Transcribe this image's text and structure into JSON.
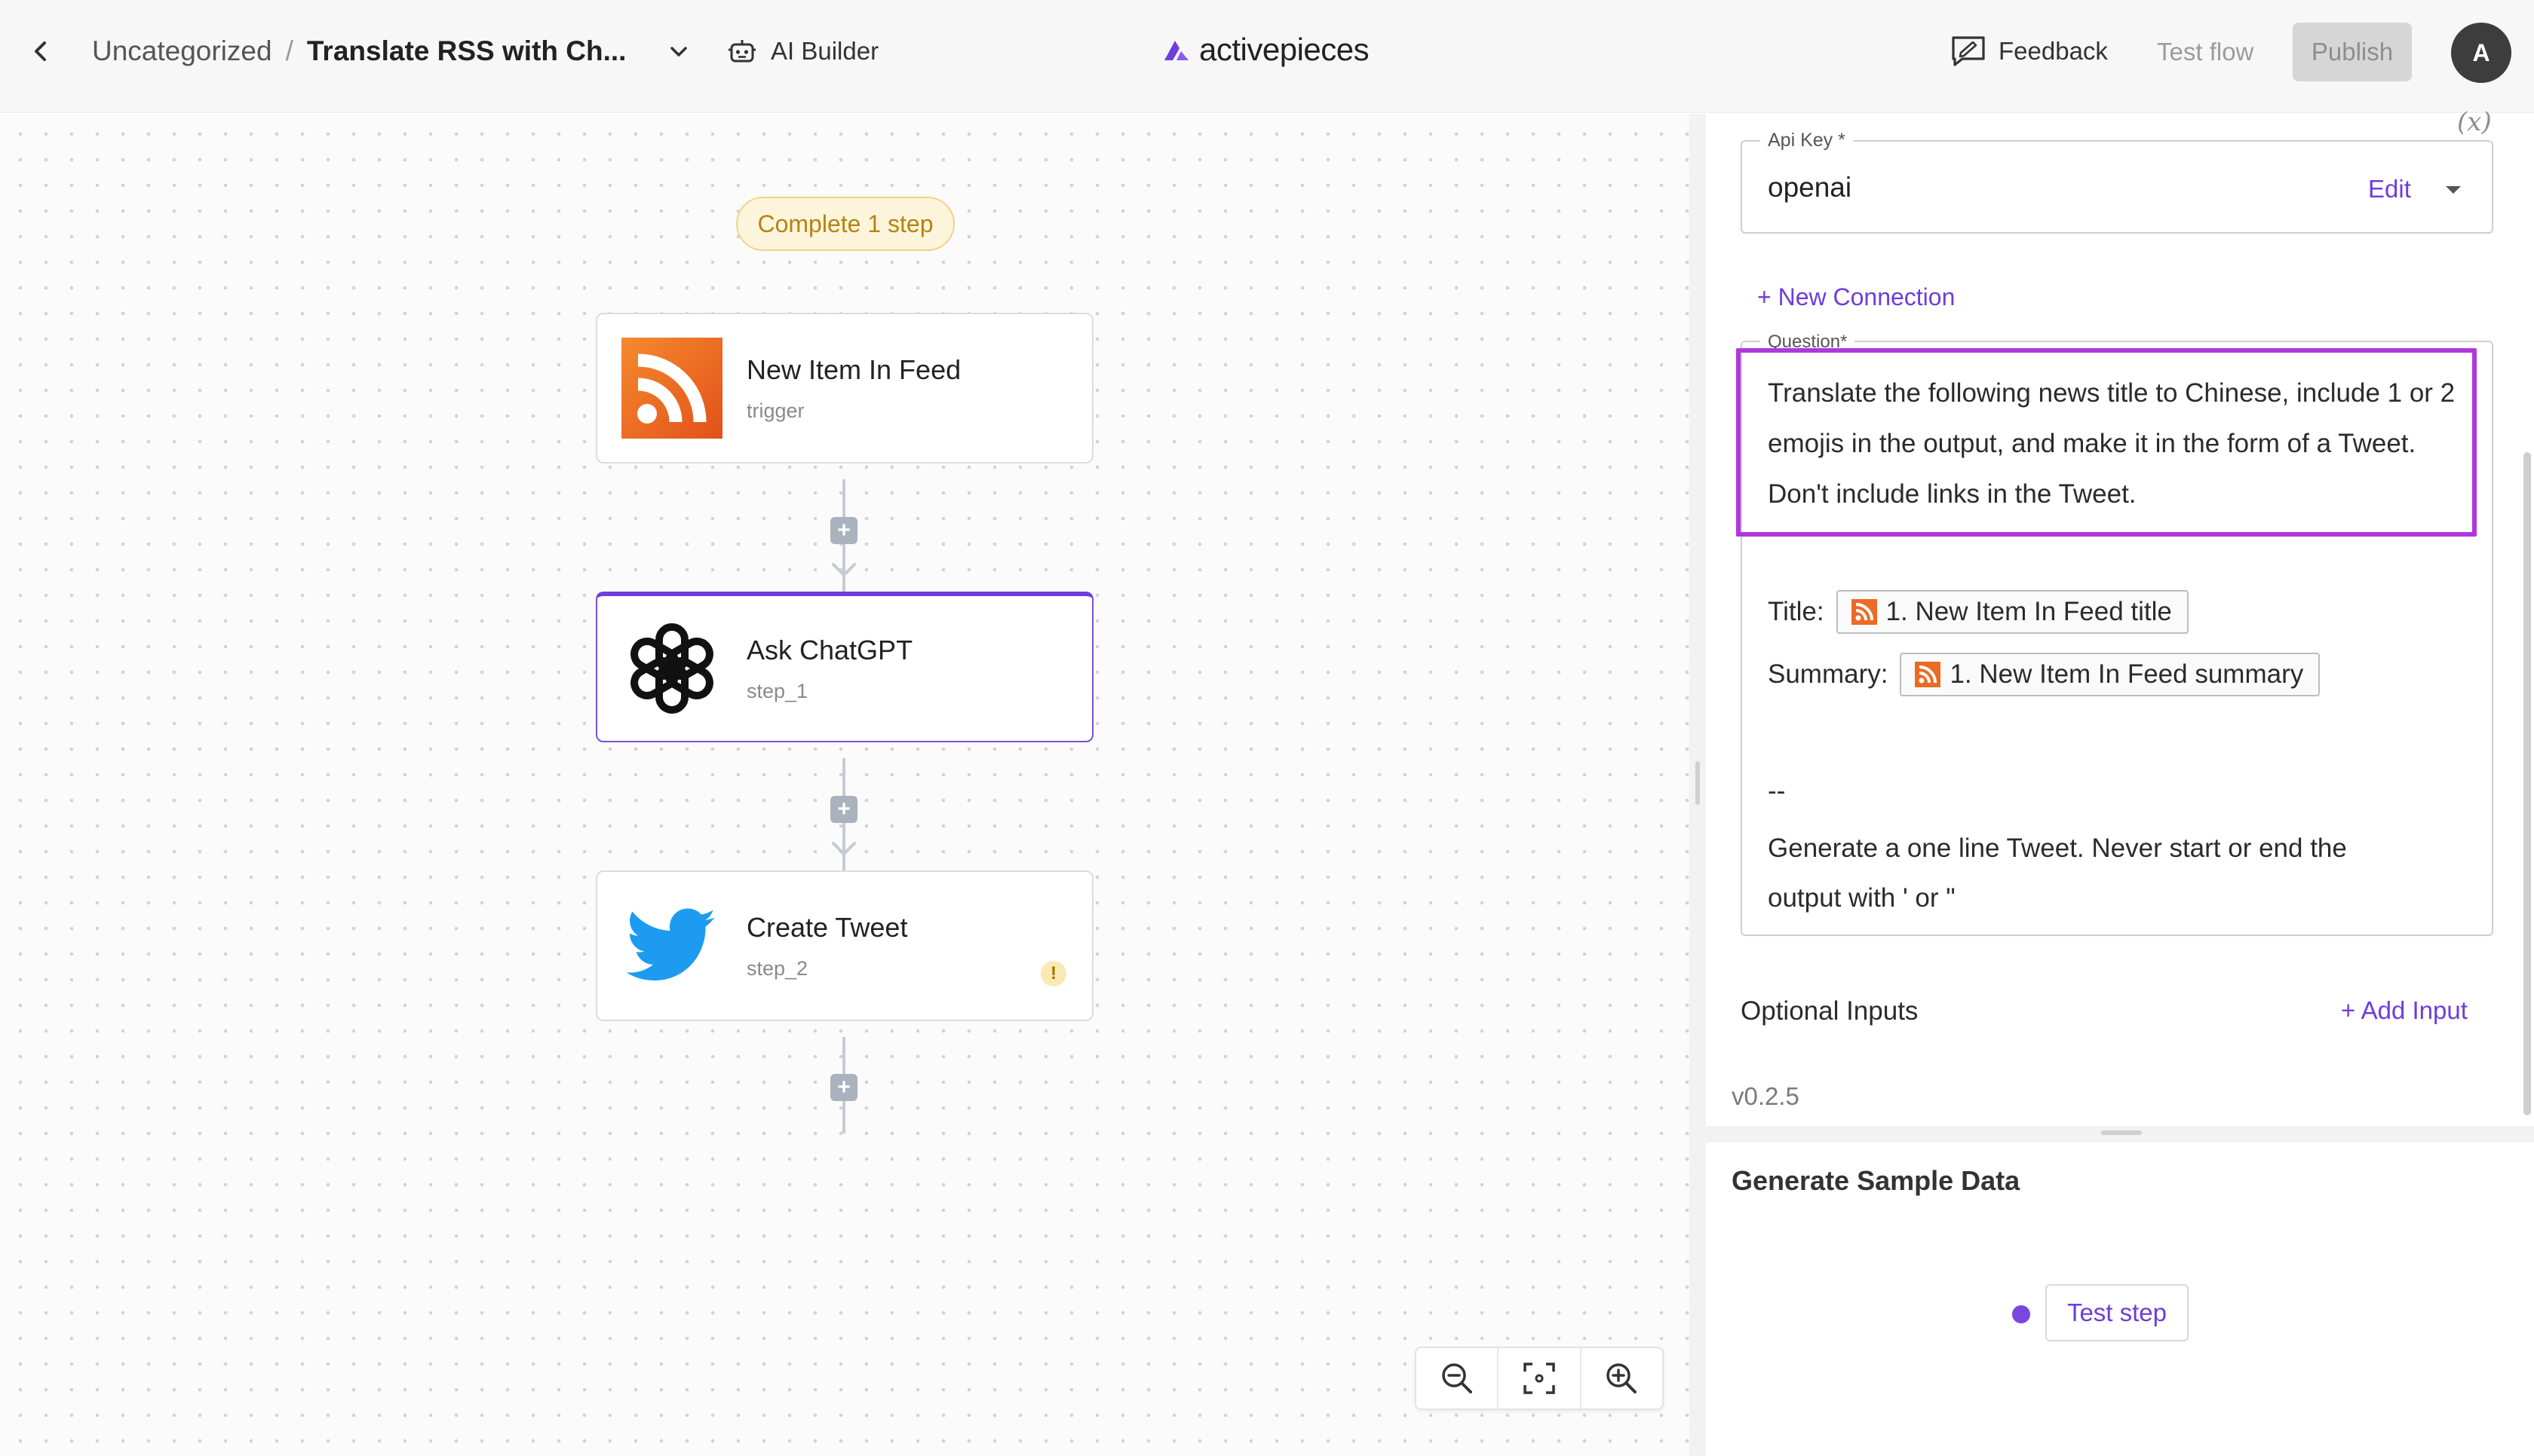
{
  "topbar": {
    "breadcrumb_folder": "Uncategorized",
    "breadcrumb_separator": "/",
    "flow_name": "Translate RSS with Ch...",
    "ai_builder_label": "AI Builder",
    "logo_text": "activepieces",
    "feedback_label": "Feedback",
    "test_flow_label": "Test flow",
    "publish_label": "Publish",
    "avatar_initial": "A"
  },
  "canvas": {
    "status_pill": "Complete 1 step",
    "steps": [
      {
        "title": "New Item In Feed",
        "subtitle": "trigger",
        "icon": "rss-icon"
      },
      {
        "title": "Ask ChatGPT",
        "subtitle": "step_1",
        "icon": "openai-icon",
        "selected": true
      },
      {
        "title": "Create Tweet",
        "subtitle": "step_2",
        "icon": "twitter-icon",
        "warning": "!"
      }
    ],
    "add_step_glyph": "+",
    "zoom_controls": [
      "zoom-out-icon",
      "fit-view-icon",
      "zoom-in-icon"
    ]
  },
  "panel": {
    "fx_label": "(x)",
    "api_key_label": "Api Key *",
    "api_key_value": "openai",
    "edit_label": "Edit",
    "new_connection_label": "+ New Connection",
    "question_label": "Question*",
    "question_paragraph": "Translate the following news title to Chinese, include 1 or 2 emojis in the output, and make it in the form of a Tweet. Don't include links in the Tweet.",
    "title_label": "Title:",
    "title_chip": "1. New Item In Feed title",
    "summary_label": "Summary:",
    "summary_chip": "1. New Item In Feed summary",
    "separator_line": "--",
    "closing_line_1": "Generate a one line Tweet. Never start or end the",
    "closing_line_2": "output with ' or \"",
    "optional_inputs_label": "Optional Inputs",
    "add_input_label": "+ Add Input",
    "version": "v0.2.5",
    "sample_data_title": "Generate Sample Data",
    "test_step_label": "Test step"
  },
  "colors": {
    "accent": "#6e3ddb",
    "highlight": "#b037db",
    "rss_orange": "#f06a1d",
    "twitter_blue": "#1d9bf0"
  }
}
